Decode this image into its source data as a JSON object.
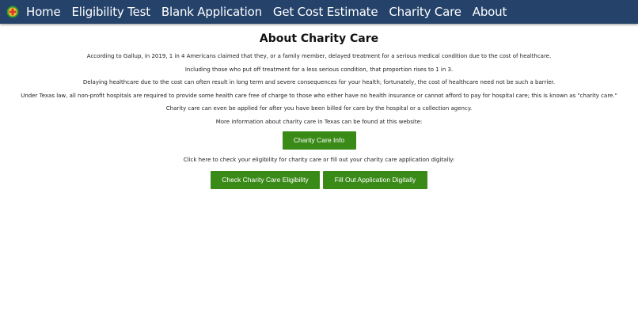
{
  "nav": {
    "logo_icon": "medical-cross-logo-icon",
    "links": [
      "Home",
      "Eligibility Test",
      "Blank Application",
      "Get Cost Estimate",
      "Charity Care",
      "About"
    ]
  },
  "page": {
    "title": "About Charity Care",
    "paragraphs": [
      "According to Gallup, in 2019, 1 in 4 Americans claimed that they, or a family member, delayed treatment for a serious medical condition due to the cost of healthcare.",
      "Including those who put off treatment for a less serious condition, that proportion rises to 1 in 3.",
      "Delaying healthcare due to the cost can often result in long term and severe consequences for your health; fortunately, the cost of healthcare need not be such a barrier.",
      "Under Texas law, all non-profit hospitals are required to provide some health care free of charge to those who either have no health insurance or cannot afford to pay for hospital care; this is known as \"charity care.\"",
      "Charity care can even be applied for after you have been billed for care by the hospital or a collection agency.",
      "More information about charity care in Texas can be found at this website:"
    ],
    "info_button": "Charity Care Info",
    "click_text": "Click here to check your eligibility for charity care or fill out your charity care application digitally:",
    "eligibility_button": "Check Charity Care Eligibility",
    "apply_button": "Fill Out Application Digitally"
  },
  "colors": {
    "navbar": "#24426a",
    "button": "#3a8a18",
    "logo_ring": "#2e9a2e",
    "logo_cross": "#d63a2a"
  }
}
